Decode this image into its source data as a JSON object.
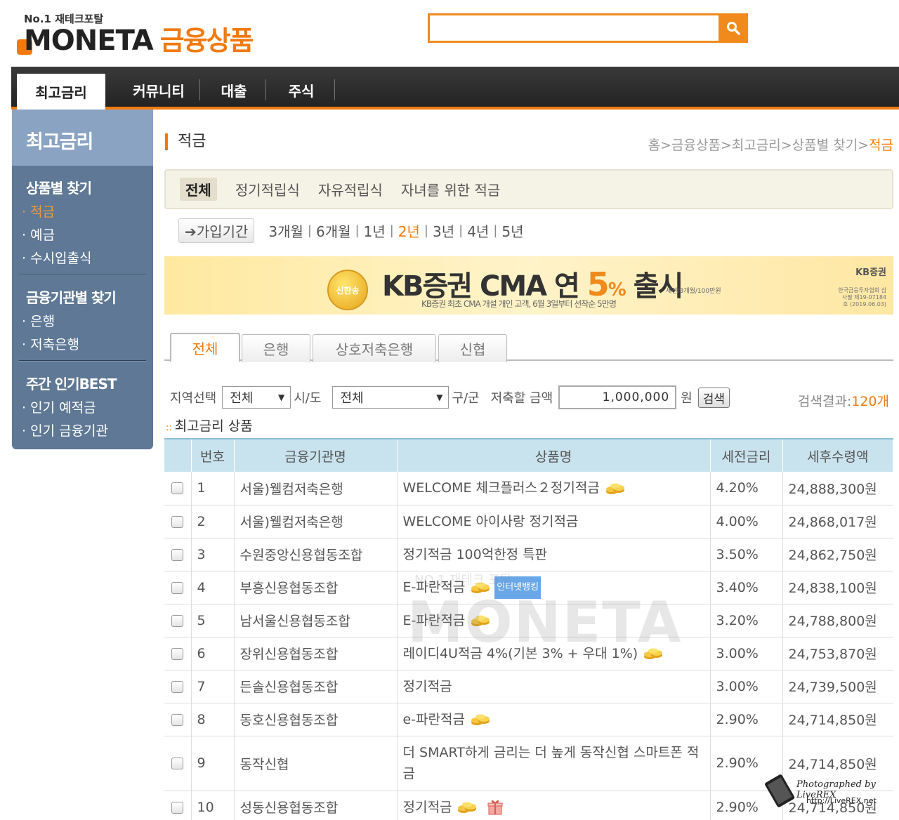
{
  "header": {
    "tagline": "No.1 재테크포탈",
    "logo_word": "MONETA",
    "logo_suffix": "금융상품",
    "search_placeholder": ""
  },
  "nav": {
    "tabs": [
      "최고금리",
      "커뮤니티",
      "대출",
      "주식"
    ],
    "active": "최고금리"
  },
  "sidebar": {
    "title": "최고금리",
    "sections": [
      {
        "heading": "상품별 찾기",
        "items": [
          "적금",
          "예금",
          "수시입출식"
        ]
      },
      {
        "heading": "금융기관별 찾기",
        "items": [
          "은행",
          "저축은행"
        ]
      },
      {
        "heading": "주간 인기BEST",
        "items": [
          "인기 예적금",
          "인기 금융기관"
        ]
      }
    ],
    "active_item": "적금"
  },
  "page": {
    "title": "적금",
    "breadcrumb": "홈>금융상품>최고금리>상품별 찾기>",
    "breadcrumb_current": "적금"
  },
  "type_bar": {
    "items": [
      "전체",
      "정기적립식",
      "자유적립식",
      "자녀를 위한 적금"
    ]
  },
  "period": {
    "label": "가입기간",
    "options": [
      "3개월",
      "6개월",
      "1년",
      "2년",
      "3년",
      "4년",
      "5년"
    ],
    "active": "2년"
  },
  "banner": {
    "coin_text": "신한송",
    "headline_pre": "KB증권 CMA 연 ",
    "headline_pct": "5",
    "headline_pct_sign": "%",
    "headline_post": " 출시",
    "subtext": "KB증권 최초 CMA 개설 개인 고객, 6월 3일부터 선착순 5만명",
    "note": "세전/3개월/100만원",
    "brand": "KB증권",
    "small_print": "한국금융투자협회 심사필 제19-07184호 (2019.06.03)"
  },
  "tabs": [
    "전체",
    "은행",
    "상호저축은행",
    "신협"
  ],
  "filter": {
    "region_label": "지역선택",
    "region_value": "전체",
    "sido_label": "시/도",
    "gugun_value": "전체",
    "gugun_label": "구/군",
    "amount_label": "저축할 금액",
    "amount_value": "1,000,000",
    "amount_unit": "원",
    "search_button": "검색",
    "result_label": "검색결과:",
    "result_count": "120개"
  },
  "list_title": "최고금리 상품",
  "table": {
    "headers": [
      "번호",
      "금융기관명",
      "상품명",
      "세전금리",
      "세후수령액"
    ],
    "rows": [
      {
        "no": "1",
        "bank": "서울)웰컴저축은행",
        "product": "WELCOME 체크플러스２정기적금",
        "coins": true,
        "ibank": false,
        "gift": false,
        "rate": "4.20%",
        "amount": "24,888,300원"
      },
      {
        "no": "2",
        "bank": "서울)웰컴저축은행",
        "product": "WELCOME 아이사랑 정기적금",
        "coins": false,
        "ibank": false,
        "gift": false,
        "rate": "4.00%",
        "amount": "24,868,017원"
      },
      {
        "no": "3",
        "bank": "수원중앙신용협동조합",
        "product": "정기적금 100억한정 특판",
        "coins": false,
        "ibank": false,
        "gift": false,
        "rate": "3.50%",
        "amount": "24,862,750원"
      },
      {
        "no": "4",
        "bank": "부흥신용협동조합",
        "product": "E-파란적금",
        "coins": true,
        "ibank": true,
        "gift": false,
        "rate": "3.40%",
        "amount": "24,838,100원"
      },
      {
        "no": "5",
        "bank": "남서울신용협동조합",
        "product": "E-파란적금",
        "coins": true,
        "ibank": false,
        "gift": false,
        "rate": "3.20%",
        "amount": "24,788,800원"
      },
      {
        "no": "6",
        "bank": "장위신용협동조합",
        "product": "레이디4U적금 4%(기본 3% + 우대 1%)",
        "coins": true,
        "ibank": false,
        "gift": false,
        "rate": "3.00%",
        "amount": "24,753,870원"
      },
      {
        "no": "7",
        "bank": "든솔신용협동조합",
        "product": "정기적금",
        "coins": false,
        "ibank": false,
        "gift": false,
        "rate": "3.00%",
        "amount": "24,739,500원"
      },
      {
        "no": "8",
        "bank": "동호신용협동조합",
        "product": "e-파란적금",
        "coins": true,
        "ibank": false,
        "gift": false,
        "rate": "2.90%",
        "amount": "24,714,850원"
      },
      {
        "no": "9",
        "bank": "동작신협",
        "product": "더 SMART하게 금리는 더 높게 동작신협 스마트폰 적금",
        "coins": false,
        "ibank": false,
        "gift": false,
        "rate": "2.90%",
        "amount": "24,714,850원"
      },
      {
        "no": "10",
        "bank": "성동신용협동조합",
        "product": "정기적금",
        "coins": true,
        "ibank": false,
        "gift": true,
        "rate": "2.90%",
        "amount": "24,714,850원"
      }
    ],
    "ibank_label": "인터넷뱅킹"
  },
  "watermark": {
    "small": "NO.1 재테크 포탈",
    "big": "MONETA"
  },
  "credit": {
    "text": "Photographed by LiveREX",
    "url": "http://LiveREX.net"
  },
  "colors": {
    "accent": "#f07a10",
    "nav_bg": "#2a2a2a",
    "sidebar_bg": "#5e7896",
    "table_header": "#c9e3ee"
  }
}
